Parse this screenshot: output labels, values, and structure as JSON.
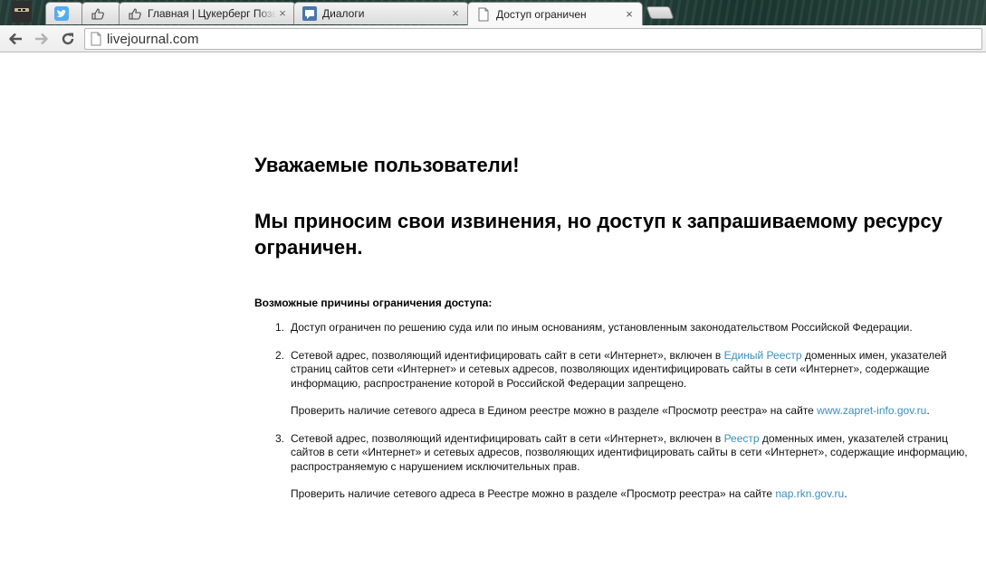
{
  "browser": {
    "tabs": [
      {
        "favicon": "twitter-icon",
        "title": "",
        "active": false
      },
      {
        "favicon": "like-hand-icon",
        "title": "",
        "active": false
      },
      {
        "favicon": "like-hand-icon",
        "title": "Главная | Цукерберг Позвонит",
        "active": false
      },
      {
        "favicon": "vk-icon",
        "title": "Диалоги",
        "active": false
      },
      {
        "favicon": "page-icon",
        "title": "Доступ ограничен",
        "active": true
      }
    ],
    "close_glyph": "×",
    "url": "livejournal.com"
  },
  "page": {
    "greeting": "Уважаемые пользователи!",
    "apology": "Мы приносим свои извинения, но доступ к запрашиваемому ресурсу ограничен.",
    "reasons_heading": "Возможные причины ограничения доступа:",
    "reasons": [
      {
        "number": "1.",
        "text": "Доступ ограничен  по решению суда или по иным основаниям, установленным законодательством Российской Федерации."
      },
      {
        "number": "2.",
        "text_before": "Сетевой адрес, позволяющий идентифицировать сайт в сети «Интернет», включен в ",
        "link": "Единый Реестр",
        "text_after": " доменных имен, указателей страниц сайтов сети «Интернет» и сетевых адресов, позволяющих идентифицировать сайты в сети «Интернет», содержащие информацию, распространение которой в Российской Федерации запрещено.",
        "check_before": "Проверить наличие сетевого адреса в Едином реестре можно в разделе «Просмотр реестра» на сайте ",
        "check_link": "www.zapret-info.gov.ru",
        "check_after": "."
      },
      {
        "number": "3.",
        "text_before": "Сетевой адрес, позволяющий идентифицировать сайт в сети «Интернет», включен в ",
        "link": "Реестр",
        "text_after": " доменных имен, указателей страниц сайтов в сети «Интернет» и сетевых адресов, позволяющих идентифицировать сайты в сети «Интернет», содержащие информацию, распространяемую с нарушением исключительных прав.",
        "check_before": "Проверить наличие сетевого адреса в Реестре можно в разделе «Просмотр реестра» на сайте ",
        "check_link": "nap.rkn.gov.ru",
        "check_after": "."
      }
    ]
  },
  "colors": {
    "link": "#3b8fb8",
    "twitter": "#55acee",
    "vk": "#4a76a8"
  }
}
